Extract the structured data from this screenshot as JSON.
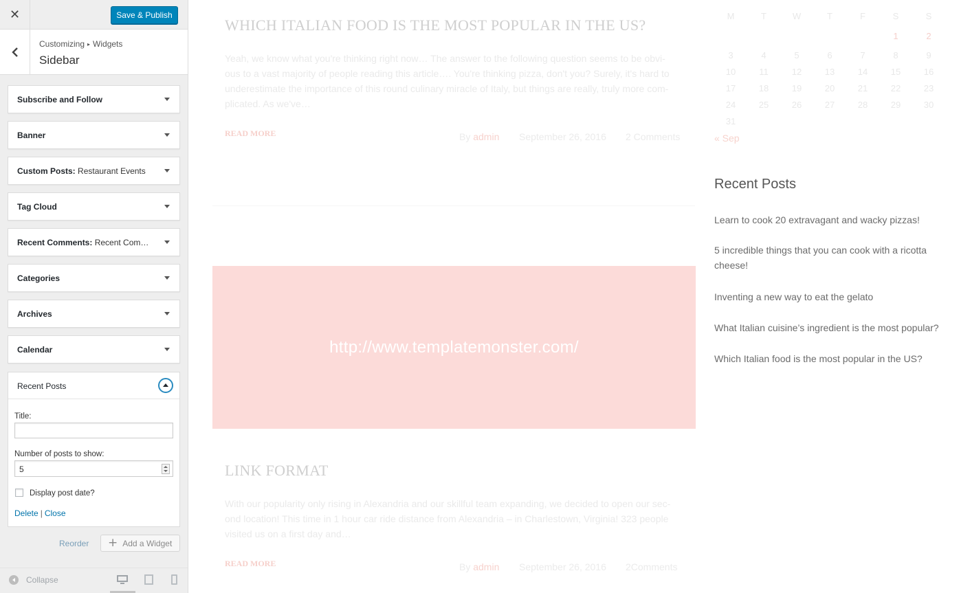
{
  "customizer": {
    "close_icon": "close-icon",
    "save_label": "Save & Publish",
    "breadcrumb": {
      "root": "Customizing",
      "child": "Widgets"
    },
    "section_title": "Sidebar",
    "widgets": [
      {
        "name": "Subscribe and Follow",
        "subtitle": ""
      },
      {
        "name": "Banner",
        "subtitle": ""
      },
      {
        "name": "Custom Posts:",
        "subtitle": "Restaurant Events"
      },
      {
        "name": "Tag Cloud",
        "subtitle": ""
      },
      {
        "name": "Recent Comments:",
        "subtitle": "Recent Com…"
      },
      {
        "name": "Categories",
        "subtitle": ""
      },
      {
        "name": "Archives",
        "subtitle": ""
      },
      {
        "name": "Calendar",
        "subtitle": ""
      }
    ],
    "open_widget": {
      "name": "Recent Posts",
      "title_label": "Title:",
      "title_value": "",
      "count_label": "Number of posts to show:",
      "count_value": "5",
      "show_date_label": "Display post date?",
      "show_date_checked": false,
      "delete_label": "Delete",
      "separator": "|",
      "close_label": "Close"
    },
    "reorder_label": "Reorder",
    "add_widget_label": "Add a Widget",
    "collapse_label": "Collapse",
    "active_device": "desktop"
  },
  "preview": {
    "post1": {
      "title": "WHICH ITALIAN FOOD IS THE MOST POPULAR IN THE US?",
      "excerpt_lines": [
        "Yeah, we know what you're thinking right now… The answer to the following question seems to be obvi-",
        "ous to a vast majority of people reading this article…. You're thinking pizza, don't you? Surely, it's hard to",
        "underestimate the importance of this round culinary miracle of Italy, but things are really, truly more com-",
        "plicated. As we've…"
      ],
      "read_more": "READ MORE",
      "by": "By",
      "author": "admin",
      "date": "September 26, 2016",
      "comments": "2 Comments"
    },
    "link_url": "http://www.templatemonster.com/",
    "post2": {
      "title": "LINK FORMAT",
      "excerpt_lines": [
        "With our popularity only rising in Alexandria and our skillful team expanding, we decided to open our sec-",
        "ond location! This time in 1 hour car ride distance from Alexandria – in Charlestown, Virginia! 323 people",
        "visited us on a first day and…"
      ],
      "read_more": "READ MORE",
      "by": "By",
      "author": "admin",
      "date": "September 26, 2016",
      "comments": "2Comments"
    },
    "calendar": {
      "weekdays": [
        "M",
        "T",
        "W",
        "T",
        "F",
        "S",
        "S"
      ],
      "weeks": [
        [
          "",
          "",
          "",
          "",
          "",
          "1",
          "2"
        ],
        [
          "3",
          "4",
          "5",
          "6",
          "7",
          "8",
          "9"
        ],
        [
          "10",
          "11",
          "12",
          "13",
          "14",
          "15",
          "16"
        ],
        [
          "17",
          "18",
          "19",
          "20",
          "21",
          "22",
          "23"
        ],
        [
          "24",
          "25",
          "26",
          "27",
          "28",
          "29",
          "30"
        ],
        [
          "31",
          "",
          "",
          "",
          "",
          "",
          ""
        ]
      ],
      "linked_days": [
        "1",
        "2"
      ],
      "prev_link": "« Sep"
    },
    "recent_posts": {
      "heading": "Recent Posts",
      "items": [
        "Learn to cook 20 extravagant and wacky pizzas!",
        "5 incredible things that you can cook with a ricotta cheese!",
        "Inventing a new way to eat the gelato",
        "What Italian cuisine’s ingredient is the most popular?",
        "Which Italian food is the most popular in the US?"
      ]
    }
  },
  "colors": {
    "primary_button": "#0085ba",
    "link": "#0073aa",
    "accent_pink": "#fcdbd9"
  }
}
